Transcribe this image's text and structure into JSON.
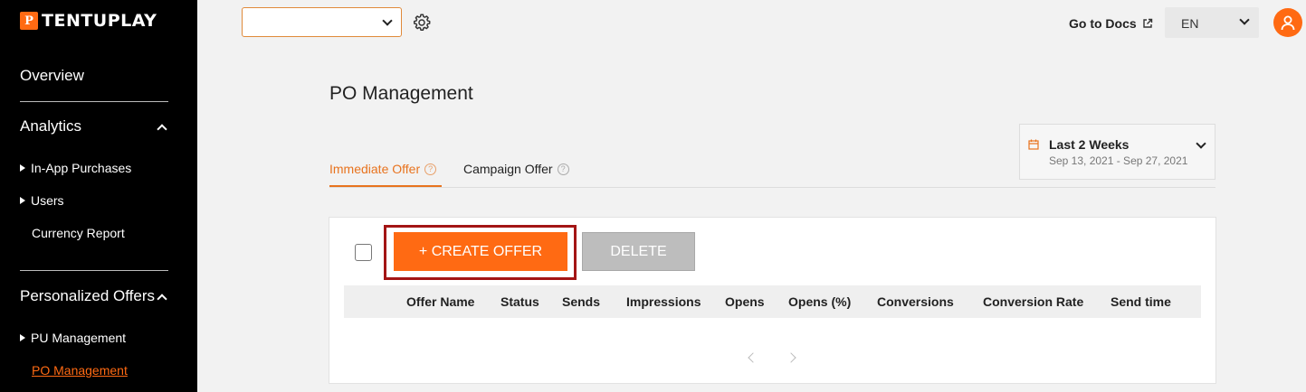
{
  "brand": {
    "logo_mark": "P",
    "logo_text": "TENTUPLAY",
    "accent_color": "#ff6a13"
  },
  "sidebar": {
    "overview": "Overview",
    "analytics": {
      "label": "Analytics",
      "items": [
        {
          "label": "In-App Purchases"
        },
        {
          "label": "Users"
        },
        {
          "label": "Currency Report"
        }
      ]
    },
    "personalized_offers": {
      "label": "Personalized Offers",
      "items": [
        {
          "label": "PU Management"
        },
        {
          "label": "PO Management"
        }
      ]
    }
  },
  "topbar": {
    "app_select_value": "",
    "docs_label": "Go to Docs",
    "language": "EN"
  },
  "main": {
    "title": "PO Management",
    "date_filter": {
      "label": "Last 2 Weeks",
      "range": "Sep 13, 2021 - Sep 27, 2021"
    },
    "tabs": [
      {
        "label": "Immediate Offer",
        "active": true
      },
      {
        "label": "Campaign Offer",
        "active": false
      }
    ],
    "actions": {
      "create_label": "+ CREATE OFFER",
      "delete_label": "DELETE"
    },
    "table": {
      "columns": [
        "Offer Name",
        "Status",
        "Sends",
        "Impressions",
        "Opens",
        "Opens (%)",
        "Conversions",
        "Conversion Rate",
        "Send time"
      ]
    }
  }
}
